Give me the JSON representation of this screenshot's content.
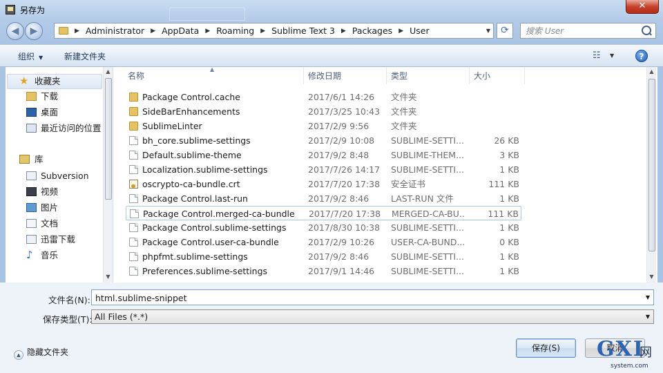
{
  "window": {
    "title": "另存为",
    "close_glyph": "✕"
  },
  "address": {
    "crumbs": [
      "Administrator",
      "AppData",
      "Roaming",
      "Sublime Text 3",
      "Packages",
      "User"
    ]
  },
  "search": {
    "placeholder": "搜索 User"
  },
  "toolbar": {
    "organize_label": "组织",
    "new_folder_label": "新建文件夹",
    "help_label": "?"
  },
  "nav": {
    "favorites_label": "收藏夹",
    "favorites": [
      "下载",
      "桌面",
      "最近访问的位置"
    ],
    "library_label": "库",
    "libraries": [
      "Subversion",
      "视频",
      "图片",
      "文档",
      "迅雷下载",
      "音乐"
    ]
  },
  "columns": {
    "name": "名称",
    "date": "修改日期",
    "type": "类型",
    "size": "大小"
  },
  "files": [
    {
      "name": "Package Control.cache",
      "date": "2017/6/1 14:26",
      "type": "文件夹",
      "size": "",
      "icon": "folder-icon"
    },
    {
      "name": "SideBarEnhancements",
      "date": "2017/3/25 10:43",
      "type": "文件夹",
      "size": "",
      "icon": "folder-icon"
    },
    {
      "name": "SublimeLinter",
      "date": "2017/2/9 9:56",
      "type": "文件夹",
      "size": "",
      "icon": "folder-icon"
    },
    {
      "name": "bh_core.sublime-settings",
      "date": "2017/2/9 10:08",
      "type": "SUBLIME-SETTI...",
      "size": "26 KB",
      "icon": "file-icon"
    },
    {
      "name": "Default.sublime-theme",
      "date": "2017/9/2 8:48",
      "type": "SUBLIME-THEM...",
      "size": "3 KB",
      "icon": "file-icon"
    },
    {
      "name": "Localization.sublime-settings",
      "date": "2017/7/26 14:17",
      "type": "SUBLIME-SETTI...",
      "size": "1 KB",
      "icon": "file-icon"
    },
    {
      "name": "oscrypto-ca-bundle.crt",
      "date": "2017/7/20 17:38",
      "type": "安全证书",
      "size": "111 KB",
      "icon": "certificate-icon"
    },
    {
      "name": "Package Control.last-run",
      "date": "2017/9/2 8:46",
      "type": "LAST-RUN 文件",
      "size": "1 KB",
      "icon": "file-icon"
    },
    {
      "name": "Package Control.merged-ca-bundle",
      "date": "2017/7/20 17:38",
      "type": "MERGED-CA-BU...",
      "size": "111 KB",
      "icon": "file-icon",
      "selected": true
    },
    {
      "name": "Package Control.sublime-settings",
      "date": "2017/8/30 10:38",
      "type": "SUBLIME-SETTI...",
      "size": "1 KB",
      "icon": "file-icon"
    },
    {
      "name": "Package Control.user-ca-bundle",
      "date": "2017/2/9 10:26",
      "type": "USER-CA-BUND...",
      "size": "0 KB",
      "icon": "file-icon"
    },
    {
      "name": "phpfmt.sublime-settings",
      "date": "2017/9/2 8:46",
      "type": "SUBLIME-SETTI...",
      "size": "1 KB",
      "icon": "file-icon"
    },
    {
      "name": "Preferences.sublime-settings",
      "date": "2017/9/1 14:46",
      "type": "SUBLIME-SETTI...",
      "size": "1 KB",
      "icon": "file-icon"
    }
  ],
  "filename": {
    "label": "文件名(N):",
    "value": "html.sublime-snippet"
  },
  "filetype": {
    "label": "保存类型(T):",
    "value": "All Files (*.*)"
  },
  "footer": {
    "hide_folders_label": "隐藏文件夹",
    "save_label": "保存(S)",
    "cancel_label": "取消"
  },
  "watermark": {
    "logo": "GXI",
    "cn": "网",
    "url": "system.com"
  }
}
